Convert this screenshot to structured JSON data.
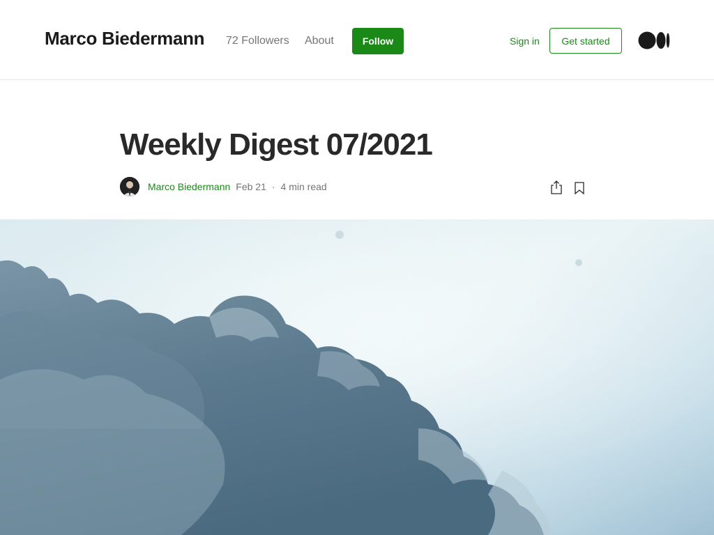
{
  "header": {
    "brand": "Marco Biedermann",
    "followers": "72 Followers",
    "about": "About",
    "follow_label": "Follow",
    "signin": "Sign in",
    "get_started": "Get started"
  },
  "article": {
    "title": "Weekly Digest 07/2021",
    "author": "Marco Biedermann",
    "date": "Feb 21",
    "separator": "·",
    "read_time": "4 min read"
  },
  "colors": {
    "accent_green": "#1a8917",
    "text_dark": "#292929",
    "text_muted": "#757575"
  },
  "icons": {
    "logo": "medium-logo-icon",
    "share": "share-icon",
    "bookmark": "bookmark-icon"
  }
}
